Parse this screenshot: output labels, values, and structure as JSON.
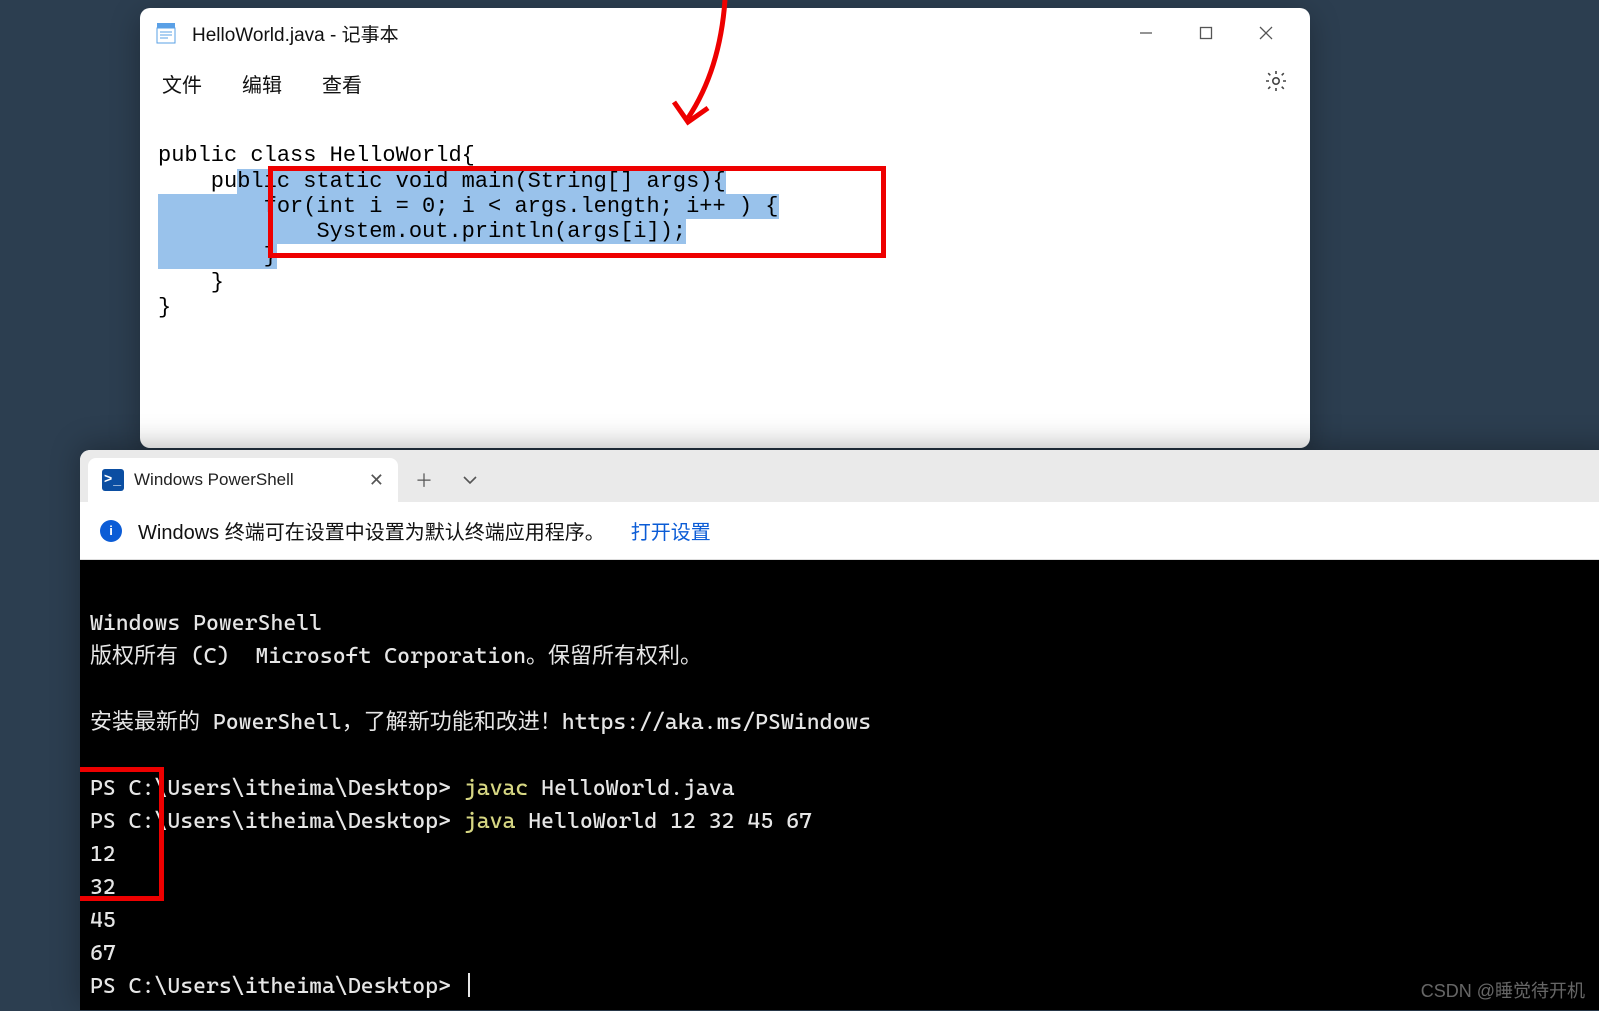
{
  "notepad": {
    "title": "HelloWorld.java - 记事本",
    "menus": [
      "文件",
      "编辑",
      "查看"
    ],
    "code": {
      "l1": "public class HelloWorld{",
      "l2_a": "    pu",
      "l2_b": "blic static void main(String[] args){",
      "l3_pad": "        ",
      "l3": "for(int i = 0; i < args.length; i++ ) {",
      "l4_pad": "            ",
      "l4": "System.out.println(args[i]);",
      "l5_pad": "        ",
      "l5": "}",
      "l6": "    }",
      "l7": "}"
    }
  },
  "terminal": {
    "tab_title": "Windows PowerShell",
    "info_text": "Windows 终端可在设置中设置为默认终端应用程序。",
    "info_link": "打开设置",
    "lines": {
      "header": "Windows PowerShell",
      "copyright": "版权所有 (C)  Microsoft Corporation。保留所有权利。",
      "install": "安装最新的 PowerShell，了解新功能和改进！https://aka.ms/PSWindows",
      "prompt": "PS C:\\Users\\itheima\\Desktop> ",
      "cmd1": "javac",
      "cmd1_args": " HelloWorld.java",
      "cmd2": "java",
      "cmd2_args": " HelloWorld 12 32 45 67",
      "out": [
        "12",
        "32",
        "45",
        "67"
      ]
    }
  },
  "watermark": "CSDN @睡觉待开机"
}
